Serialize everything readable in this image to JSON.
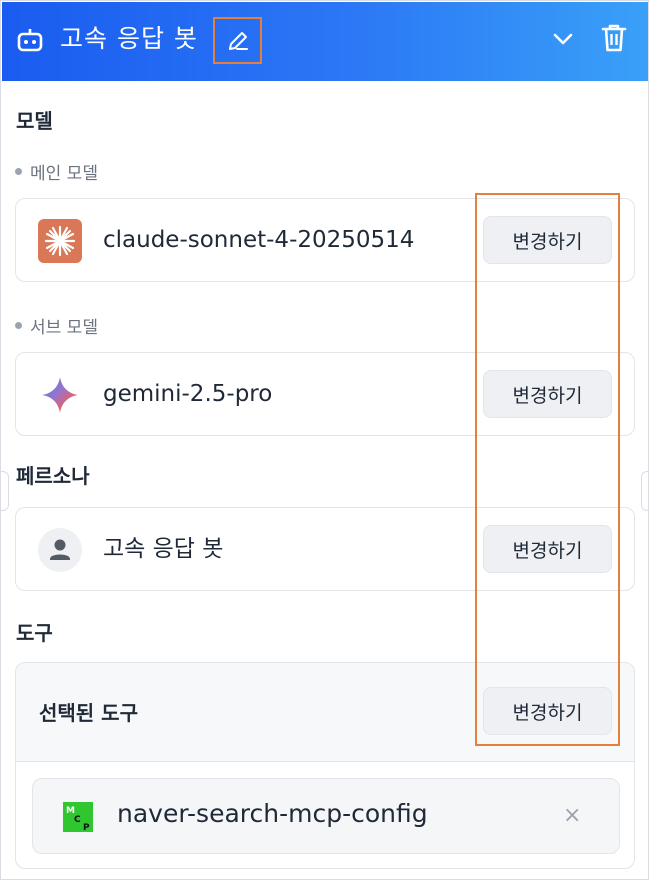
{
  "header": {
    "title": "고속 응답 봇",
    "bot_icon": "robot-icon",
    "edit_icon": "pencil-icon",
    "collapse_icon": "chevron-down-icon",
    "delete_icon": "trash-icon"
  },
  "model_section": {
    "label": "모델",
    "main": {
      "label": "메인 모델",
      "name": "claude-sonnet-4-20250514",
      "icon": "claude-logo-icon",
      "button": "변경하기"
    },
    "sub": {
      "label": "서브 모델",
      "name": "gemini-2.5-pro",
      "icon": "gemini-logo-icon",
      "button": "변경하기"
    }
  },
  "persona_section": {
    "label": "페르소나",
    "name": "고속 응답 봇",
    "icon": "person-icon",
    "button": "변경하기"
  },
  "tools_section": {
    "label": "도구",
    "selected_title": "선택된 도구",
    "button": "변경하기",
    "items": [
      {
        "name": "naver-search-mcp-config",
        "icon": "mcp-icon",
        "remove": "×"
      }
    ]
  },
  "colors": {
    "header_start": "#1a5cf0",
    "header_end": "#39a0f8",
    "highlight": "#e2803c",
    "claude": "#d97757"
  }
}
